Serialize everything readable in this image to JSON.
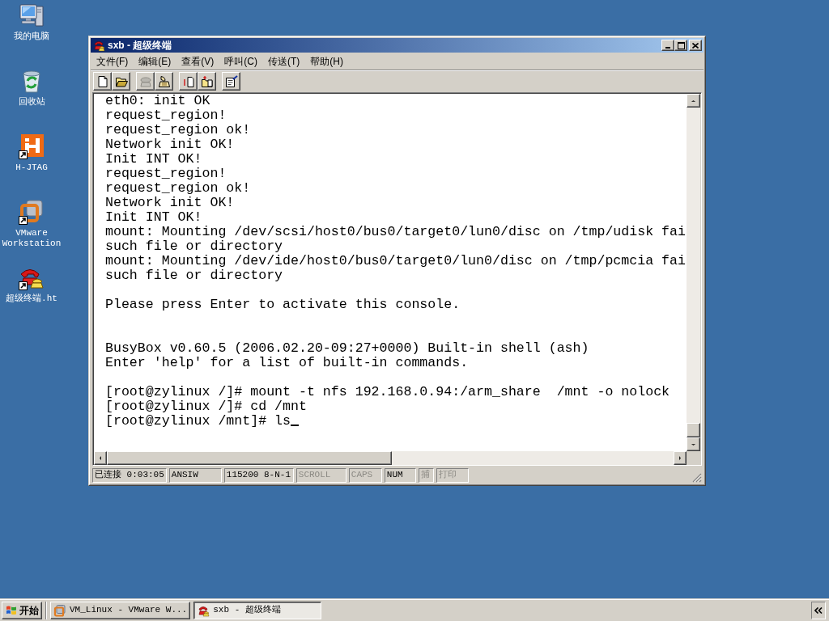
{
  "desktop_icons": [
    {
      "kind": "computer",
      "label": "我的电脑",
      "shortcut": false
    },
    {
      "kind": "recycle_bin",
      "label": "回收站",
      "shortcut": false
    },
    {
      "kind": "jtag",
      "label": "H-JTAG",
      "shortcut": true
    },
    {
      "kind": "vmware",
      "label": "VMware Workstation",
      "shortcut": true
    },
    {
      "kind": "terminal",
      "label": "超级终端.ht",
      "shortcut": true
    }
  ],
  "window": {
    "title": "sxb - 超级终端",
    "menu": [
      "文件(F)",
      "编辑(E)",
      "查看(V)",
      "呼叫(C)",
      "传送(T)",
      "帮助(H)"
    ],
    "toolbar": [
      {
        "buttons": [
          {
            "kind": "new",
            "disabled": false
          },
          {
            "kind": "open",
            "disabled": false
          }
        ]
      },
      {
        "buttons": [
          {
            "kind": "call",
            "disabled": true
          },
          {
            "kind": "hangup",
            "disabled": false
          }
        ]
      },
      {
        "buttons": [
          {
            "kind": "send",
            "disabled": false
          },
          {
            "kind": "receive",
            "disabled": false
          }
        ]
      },
      {
        "buttons": [
          {
            "kind": "properties",
            "disabled": false
          }
        ]
      }
    ],
    "terminal": {
      "lines": [
        {
          "kind": "text",
          "text": "eth0: init OK"
        },
        {
          "kind": "text",
          "text": "request_region!"
        },
        {
          "kind": "text",
          "text": "request_region ok!"
        },
        {
          "kind": "text",
          "text": "Network init OK!"
        },
        {
          "kind": "text",
          "text": "Init INT OK!"
        },
        {
          "kind": "text",
          "text": "request_region!"
        },
        {
          "kind": "text",
          "text": "request_region ok!"
        },
        {
          "kind": "text",
          "text": "Network init OK!"
        },
        {
          "kind": "text",
          "text": "Init INT OK!"
        },
        {
          "kind": "text",
          "text": "mount: Mounting /dev/scsi/host0/bus0/target0/lun0/disc on /tmp/udisk fai"
        },
        {
          "kind": "text",
          "text": "such file or directory"
        },
        {
          "kind": "text",
          "text": "mount: Mounting /dev/ide/host0/bus0/target0/lun0/disc on /tmp/pcmcia fai"
        },
        {
          "kind": "text",
          "text": "such file or directory"
        },
        {
          "kind": "blank"
        },
        {
          "kind": "text",
          "text": "Please press Enter to activate this console."
        },
        {
          "kind": "blank"
        },
        {
          "kind": "blank"
        },
        {
          "kind": "text",
          "text": "BusyBox v0.60.5 (2006.02.20-09:27+0000) Built-in shell (ash)"
        },
        {
          "kind": "text",
          "text": "Enter 'help' for a list of built-in commands."
        },
        {
          "kind": "blank"
        },
        {
          "kind": "text",
          "text": "[root@zylinux /]# mount -t nfs 192.168.0.94:/arm_share  /mnt -o nolock"
        },
        {
          "kind": "text",
          "text": "[root@zylinux /]# cd /mnt"
        }
      ],
      "input": {
        "text": "[root@zylinux /mnt]# ls",
        "cursor": true
      }
    },
    "status_bar": [
      {
        "kind": "field",
        "text": "已连接 0:03:05"
      },
      {
        "kind": "field",
        "text": "ANSIW"
      },
      {
        "kind": "field",
        "text": "115200 8-N-1"
      },
      {
        "kind": "indicator",
        "text": "SCROLL",
        "active": false
      },
      {
        "kind": "indicator",
        "text": "CAPS",
        "active": false
      },
      {
        "kind": "indicator",
        "text": "NUM",
        "active": true
      },
      {
        "kind": "indicator",
        "text": "捕",
        "active": false
      },
      {
        "kind": "indicator",
        "text": "打印",
        "active": false
      }
    ]
  },
  "taskbar": {
    "start": "开始",
    "tasks": [
      {
        "kind": "vmware",
        "label": "VM_Linux - VMware W...",
        "selected": false
      },
      {
        "kind": "terminal",
        "label": "sxb - 超级终端",
        "selected": true
      }
    ]
  }
}
